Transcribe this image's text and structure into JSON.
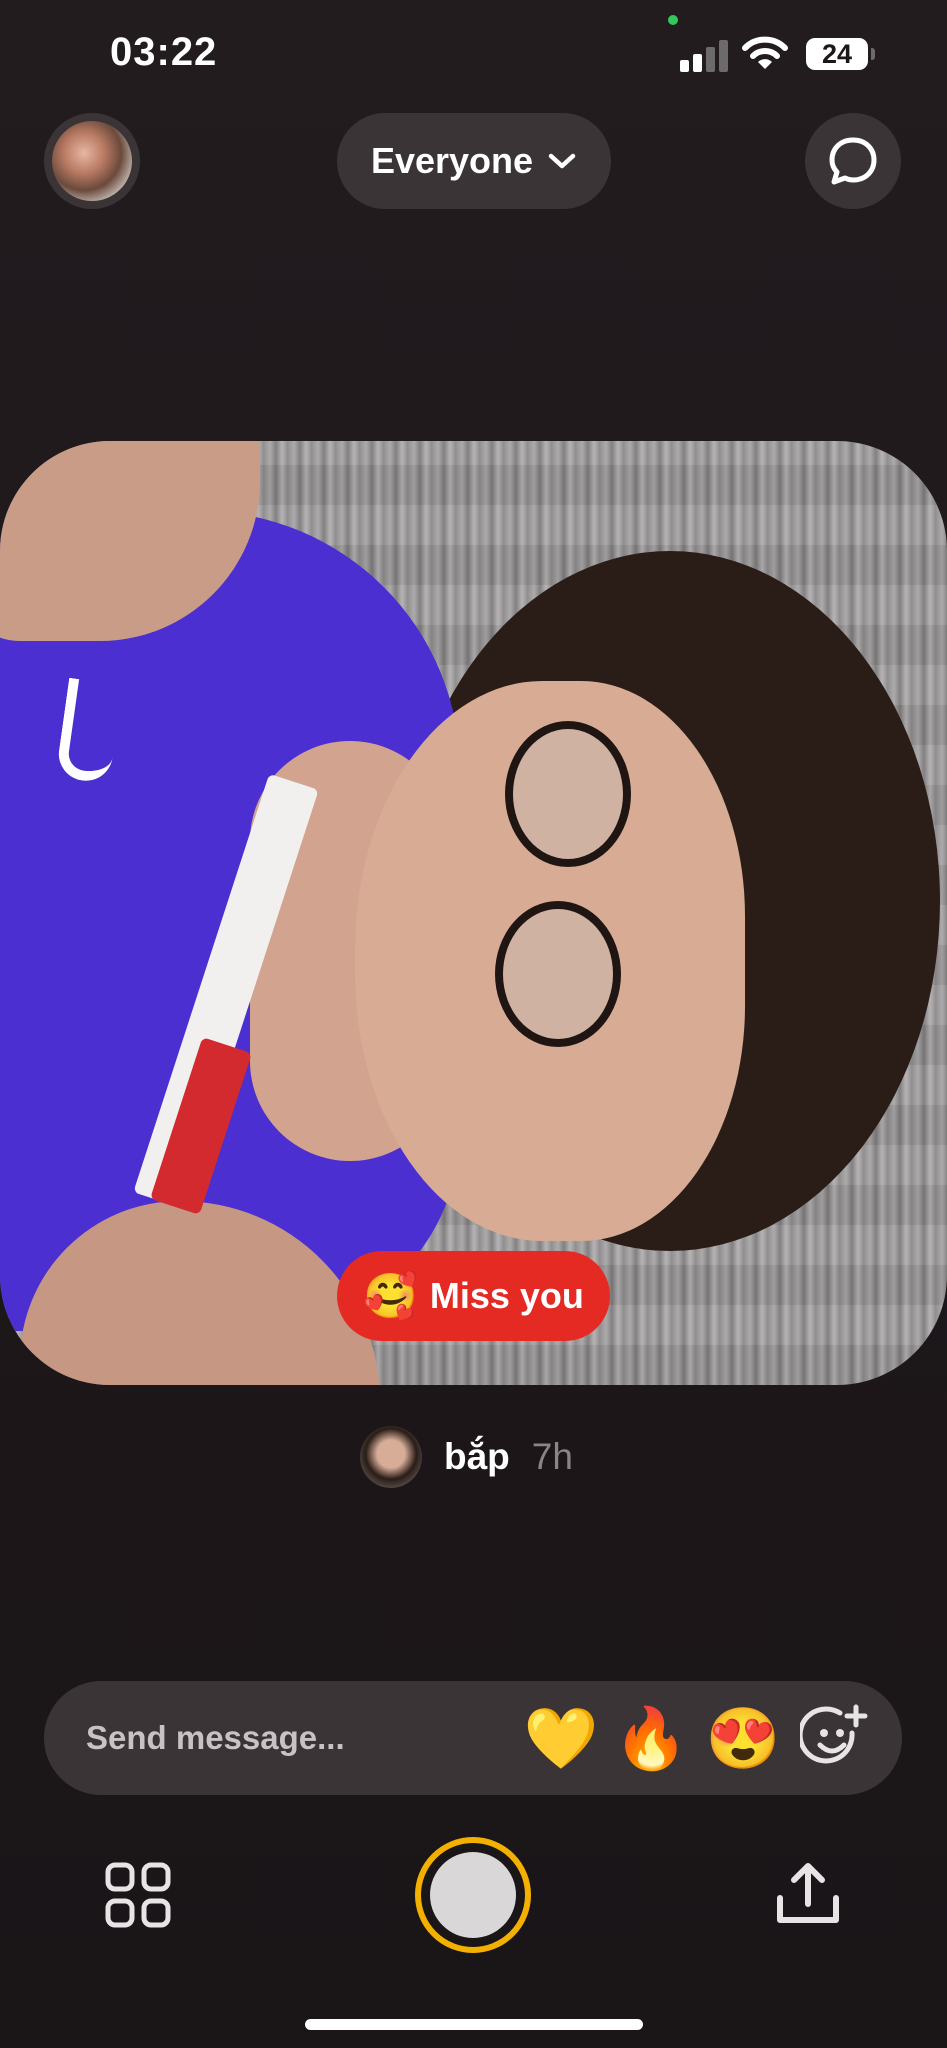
{
  "status_bar": {
    "time": "03:22",
    "battery": "24"
  },
  "header": {
    "audience_label": "Everyone",
    "audience_icon": "chevron-down-icon",
    "chat_icon": "chat-bubble-icon"
  },
  "post": {
    "caption_emoji": "🥰",
    "caption_text": "Miss you",
    "author_name": "bắp",
    "posted_ago": "7h"
  },
  "message_bar": {
    "placeholder": "Send message...",
    "reactions": [
      "💛",
      "🔥",
      "😍"
    ],
    "emoji_picker_icon": "add-emoji-icon"
  },
  "bottom_bar": {
    "grid_icon": "grid-icon",
    "shutter_icon": "shutter-button",
    "share_icon": "share-icon"
  },
  "colors": {
    "background": "#1c1719",
    "control_bg": "#3a3436",
    "caption_red": "#e52a24",
    "shutter_ring": "#f4b000"
  }
}
